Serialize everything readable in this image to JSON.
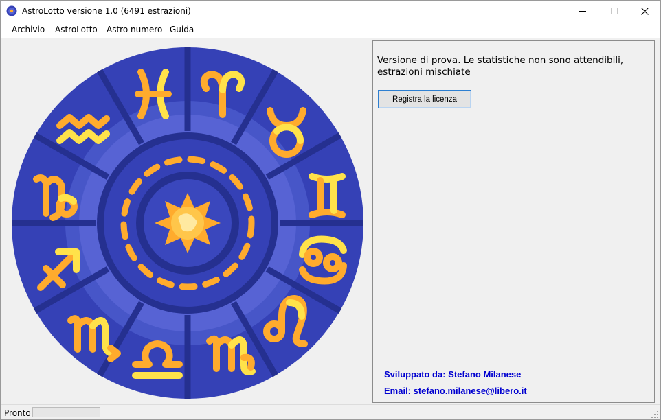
{
  "window": {
    "title": "AstroLotto versione 1.0 (6491 estrazioni)"
  },
  "menu": {
    "items": [
      "Archivio",
      "AstroLotto",
      "Astro numero",
      "Guida"
    ]
  },
  "panel": {
    "notice": "Versione di prova. Le statistiche non sono attendibili, estrazioni mischiate",
    "license_button": "Registra la licenza",
    "developer": "Sviluppato da: Stefano Milanese",
    "email": "Email: stefano.milanese@libero.it"
  },
  "status": {
    "text": "Pronto"
  },
  "colors": {
    "wheel_outer": "#3541b6",
    "wheel_ring": "#4756c8",
    "wheel_inner": "#5763d4",
    "spoke": "#253090",
    "symbol_orange": "#ffab2d",
    "symbol_yellow": "#ffe24a",
    "link_blue": "#0000d0"
  },
  "icons": {
    "app": "astro-wheel-icon",
    "center": "sun-icon",
    "zodiac": [
      "pisces-icon",
      "aries-icon",
      "taurus-icon",
      "gemini-icon",
      "cancer-icon",
      "leo-icon",
      "virgo-icon",
      "libra-icon",
      "scorpio-icon",
      "sagittarius-icon",
      "capricorn-icon",
      "aquarius-icon"
    ]
  }
}
